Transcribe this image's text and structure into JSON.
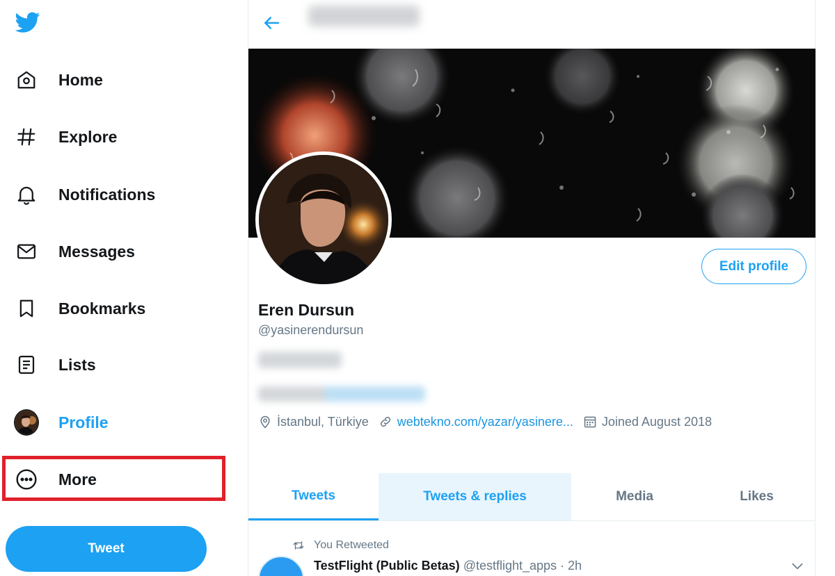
{
  "colors": {
    "accent": "#1da1f2",
    "highlight": "#e0212b",
    "text": "#14171a",
    "muted": "#657786"
  },
  "sidebar": {
    "logo_icon": "twitter-bird-icon",
    "items": [
      {
        "label": "Home",
        "icon": "home-icon"
      },
      {
        "label": "Explore",
        "icon": "hashtag-icon"
      },
      {
        "label": "Notifications",
        "icon": "bell-icon"
      },
      {
        "label": "Messages",
        "icon": "envelope-icon"
      },
      {
        "label": "Bookmarks",
        "icon": "bookmark-icon"
      },
      {
        "label": "Lists",
        "icon": "list-icon"
      },
      {
        "label": "Profile",
        "icon": "avatar",
        "active": true
      },
      {
        "label": "More",
        "icon": "more-circle-icon",
        "highlighted": true
      }
    ],
    "tweet_button": "Tweet"
  },
  "profile": {
    "name": "Eren Dursun",
    "handle": "@yasinerendursun",
    "edit_button": "Edit profile",
    "location": "İstanbul, Türkiye",
    "website": "webtekno.com/yazar/yasinere...",
    "joined": "Joined August 2018"
  },
  "tabs": [
    "Tweets",
    "Tweets & replies",
    "Media",
    "Likes"
  ],
  "timeline": {
    "retweet_label": "You Retweeted",
    "first_tweet": {
      "author": "TestFlight (Public Betas)",
      "meta": "@testflight_apps · 2h"
    }
  }
}
